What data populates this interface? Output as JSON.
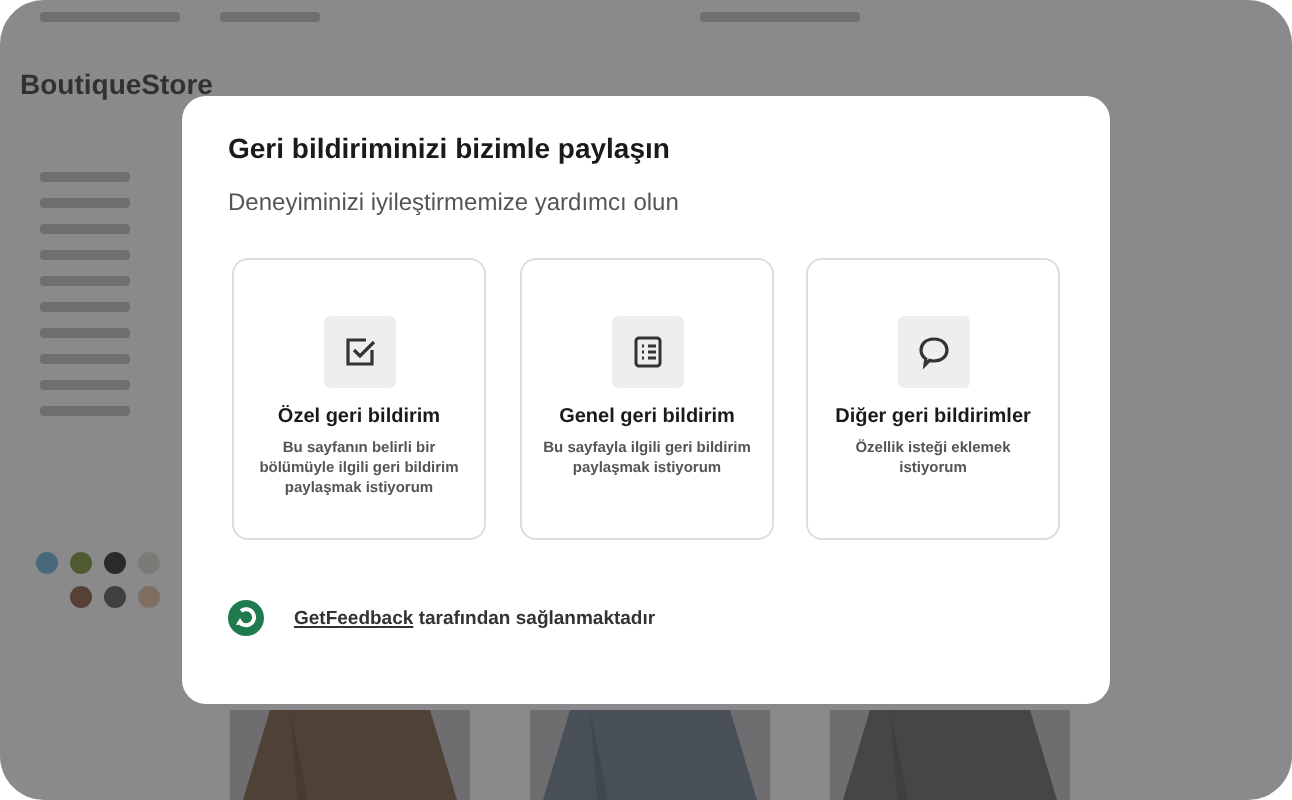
{
  "store": {
    "brand": "BoutiqueStore"
  },
  "dialog": {
    "title": "Geri bildiriminizi bizimle paylaşın",
    "subtitle": "Deneyiminizi iyileştirmemize yardımcı olun",
    "options": [
      {
        "kind": "check",
        "title": "Özel geri bildirim",
        "description": "Bu sayfanın belirli bir bölümüyle ilgili geri bildirim paylaşmak istiyorum"
      },
      {
        "kind": "list",
        "title": "Genel geri bildirim",
        "description": "Bu sayfayla ilgili geri bildirim paylaşmak istiyorum"
      },
      {
        "kind": "bubble",
        "title": "Diğer geri bildirimler",
        "description": "Özellik isteği eklemek istiyorum"
      }
    ],
    "footer": {
      "link": "GetFeedback",
      "text": "tarafından sağlanmaktadır"
    }
  }
}
